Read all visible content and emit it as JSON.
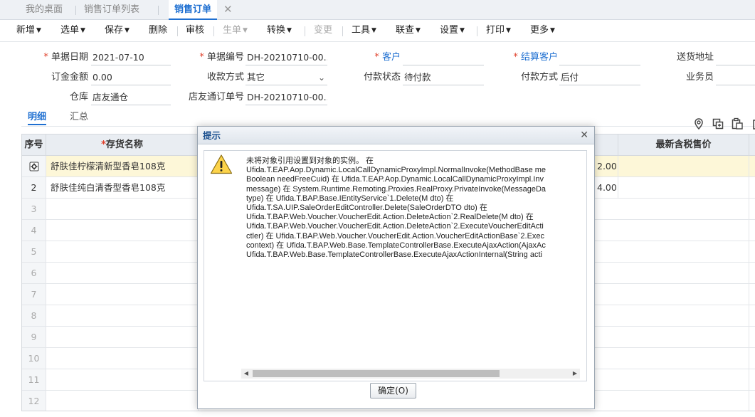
{
  "tabs": [
    {
      "label": "我的桌面"
    },
    {
      "label": "销售订单列表"
    },
    {
      "label": "销售订单",
      "active": true
    }
  ],
  "tab_close_glyph": "✕",
  "toolbar": {
    "items": [
      {
        "label": "新增",
        "dropdown": true
      },
      {
        "label": "选单",
        "dropdown": true
      },
      {
        "label": "保存",
        "dropdown": true
      },
      {
        "label": "删除",
        "dropdown": false
      },
      {
        "label": "审核",
        "dropdown": false
      },
      {
        "label": "生单",
        "dropdown": true,
        "disabled": true
      },
      {
        "label": "转换",
        "dropdown": true
      },
      {
        "label": "变更",
        "dropdown": false,
        "disabled": true
      },
      {
        "label": "工具",
        "dropdown": true
      },
      {
        "label": "联查",
        "dropdown": true
      },
      {
        "label": "设置",
        "dropdown": true
      },
      {
        "label": "打印",
        "dropdown": true
      },
      {
        "label": "更多",
        "dropdown": true
      }
    ]
  },
  "form": {
    "doc_date_label": "单据日期",
    "doc_date_value": "2021-07-10",
    "doc_no_label": "单据编号",
    "doc_no_value": "DH-20210710-00...",
    "customer_label": "客户",
    "customer_value": "",
    "settle_customer_label": "结算客户",
    "settle_customer_value": "",
    "ship_addr_label": "送货地址",
    "ship_addr_value": "",
    "deposit_label": "订金金额",
    "deposit_value": "0.00",
    "collect_method_label": "收款方式",
    "collect_method_value": "其它",
    "pay_status_label": "付款状态",
    "pay_status_value": "待付款",
    "pay_method_label": "付款方式",
    "pay_method_value": "后付",
    "salesman_label": "业务员",
    "salesman_value": "",
    "warehouse_label": "仓库",
    "warehouse_value": "店友通仓",
    "store_order_label": "店友通订单号",
    "store_order_value": "DH-20210710-00..."
  },
  "subtabs": [
    {
      "label": "明细",
      "active": true
    },
    {
      "label": "汇总",
      "active": false
    }
  ],
  "grid": {
    "headers": {
      "index": "序号",
      "name": "存货名称",
      "price": "最新含税售价"
    },
    "rows": [
      {
        "index": "",
        "name": "舒肤佳柠檬清新型香皂108克",
        "amount": "2.00",
        "selected": true
      },
      {
        "index": "2",
        "name": "舒肤佳纯白清香型香皂108克",
        "amount": "4.00",
        "selected": false
      },
      {
        "index": "3",
        "name": "",
        "amount": ""
      },
      {
        "index": "4",
        "name": "",
        "amount": ""
      },
      {
        "index": "5",
        "name": "",
        "amount": ""
      },
      {
        "index": "6",
        "name": "",
        "amount": ""
      },
      {
        "index": "7",
        "name": "",
        "amount": ""
      },
      {
        "index": "8",
        "name": "",
        "amount": ""
      },
      {
        "index": "9",
        "name": "",
        "amount": ""
      },
      {
        "index": "10",
        "name": "",
        "amount": ""
      },
      {
        "index": "11",
        "name": "",
        "amount": ""
      },
      {
        "index": "12",
        "name": "",
        "amount": ""
      }
    ]
  },
  "dialog": {
    "title": "提示",
    "close_glyph": "✕",
    "icon": "warning-icon",
    "message": "未将对象引用设置到对象的实例。 在\nUfida.T.EAP.Aop.Dynamic.LocalCallDynamicProxyImpl.NormalInvoke(MethodBase me\nBoolean needFreeCuid) 在 Ufida.T.EAP.Aop.Dynamic.LocalCallDynamicProxyImpl.Inv\nmessage) 在 System.Runtime.Remoting.Proxies.RealProxy.PrivateInvoke(MessageDa\ntype) 在 Ufida.T.BAP.Base.IEntityService`1.Delete(M dto) 在\nUfida.T.SA.UIP.SaleOrderEditController.Delete(SaleOrderDTO dto) 在\nUfida.T.BAP.Web.Voucher.VoucherEdit.Action.DeleteAction`2.RealDelete(M dto) 在\nUfida.T.BAP.Web.Voucher.VoucherEdit.Action.DeleteAction`2.ExecuteVoucherEditActi\nctler) 在 Ufida.T.BAP.Web.Voucher.VoucherEdit.Action.VoucherEditActionBase`2.Exec\ncontext) 在 Ufida.T.BAP.Web.Base.TemplateControllerBase.ExecuteAjaxAction(AjaxAc\nUfida.T.BAP.Web.Base.TemplateControllerBase.ExecuteAjaxActionInternal(String acti",
    "ok_label": "确定(O)"
  },
  "colors": {
    "accent": "#1e6fd1",
    "required": "#e0402b",
    "selected_row": "#fdf7d8",
    "header_bg": "#e9edf2"
  }
}
